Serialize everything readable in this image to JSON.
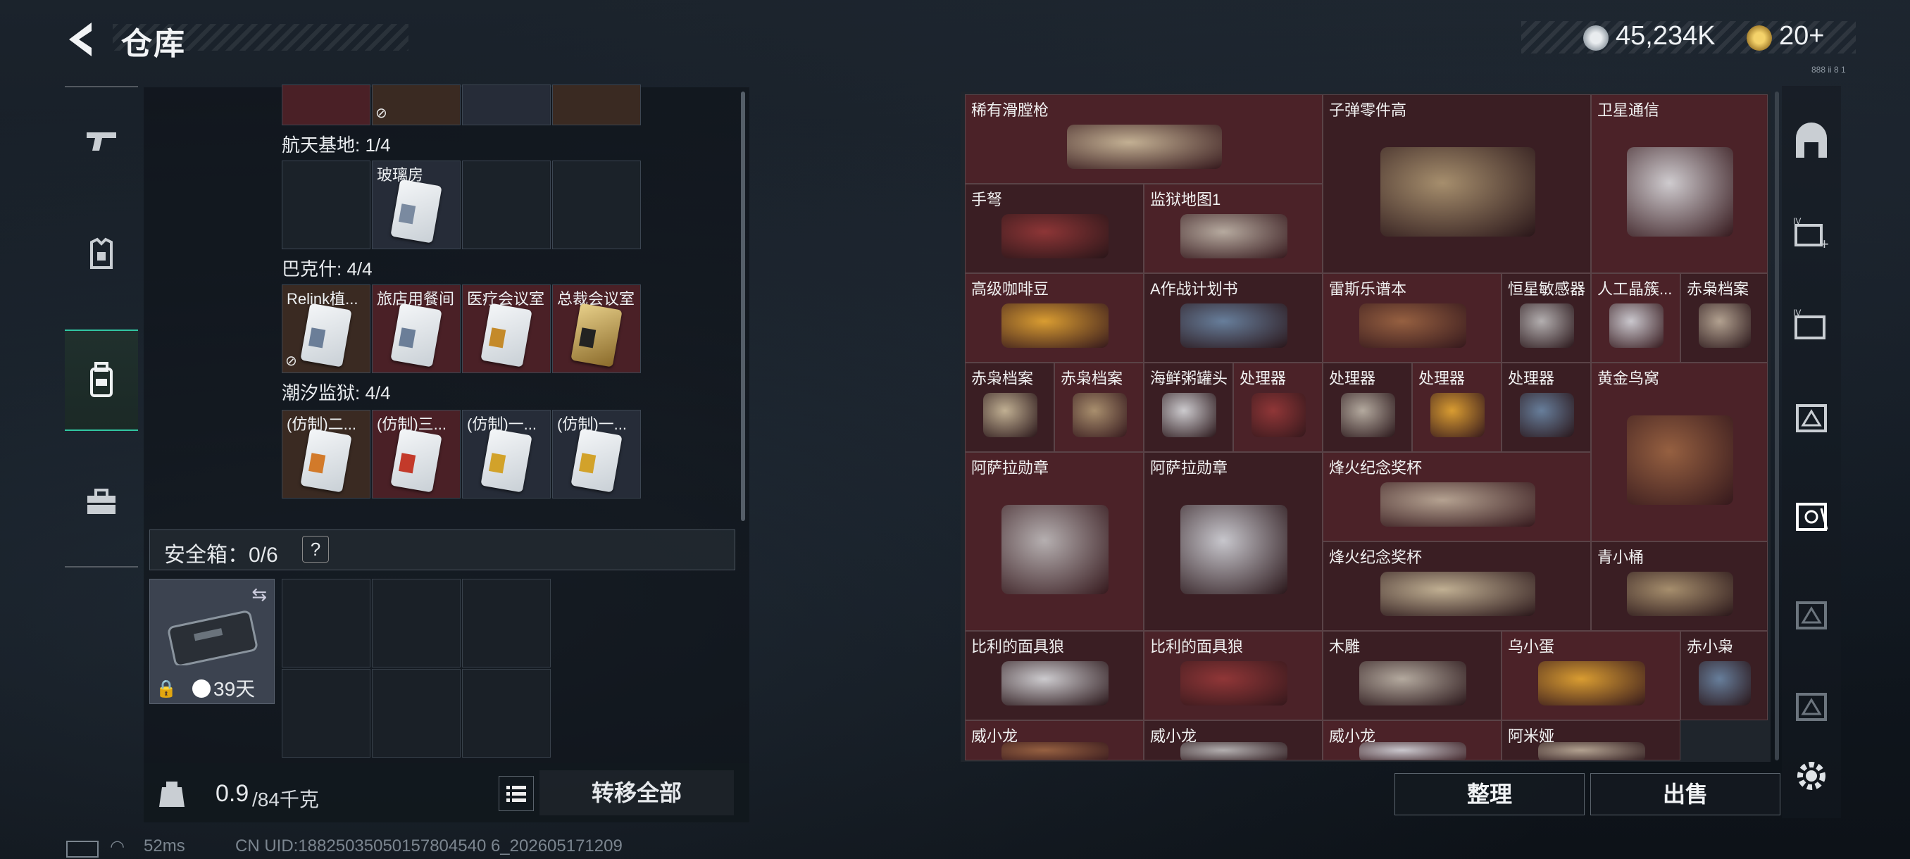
{
  "header": {
    "title": "仓库",
    "currency1": "45,234K",
    "currency2": "20+",
    "small_tag": "888 ii 8 1"
  },
  "left_panel": {
    "sections": [
      {
        "name": "航天基地: 1/4",
        "cells": [
          {
            "label": ""
          },
          {
            "label": "玻璃房"
          },
          {
            "label": ""
          },
          {
            "label": ""
          }
        ]
      },
      {
        "name": "巴克什: 4/4",
        "cells": [
          {
            "label": "Relink植..."
          },
          {
            "label": "旅店用餐间"
          },
          {
            "label": "医疗会议室"
          },
          {
            "label": "总裁会议室"
          }
        ]
      },
      {
        "name": "潮汐监狱: 4/4",
        "cells": [
          {
            "label": "(仿制)二..."
          },
          {
            "label": "(仿制)三..."
          },
          {
            "label": "(仿制)一..."
          },
          {
            "label": "(仿制)一..."
          }
        ]
      }
    ],
    "safe_label": "安全箱：0/6",
    "safe_help": "?",
    "safe_days": "39天",
    "weight_current": "0.9",
    "weight_max": "/84千克",
    "transfer_all": "转移全部"
  },
  "grid_items": [
    "稀有滑膛枪",
    "子弹零件高",
    "卫星通信",
    "手弩",
    "监狱地图1",
    "高级咖啡豆",
    "A作战计划书",
    "雷斯乐谱本",
    "恒星敏感器",
    "人工晶簇...",
    "赤枭档案",
    "赤枭档案",
    "赤枭档案",
    "海鲜粥罐头",
    "处理器",
    "处理器",
    "处理器",
    "处理器",
    "黄金鸟窝",
    "阿萨拉勋章",
    "阿萨拉勋章",
    "烽火纪念奖杯",
    "烽火纪念奖杯",
    "青小桶",
    "比利的面具狼",
    "比利的面具狼",
    "木雕",
    "乌小蛋",
    "赤小枭",
    "威小龙",
    "威小龙",
    "威小龙",
    "阿米娅"
  ],
  "right_buttons": {
    "sort": "整理",
    "sell": "出售"
  },
  "status": {
    "ping": "52ms",
    "uid": "CN UID:18825035050157804540 6_202605171209"
  },
  "icons": [
    "back-icon",
    "coin-icon",
    "gold-coin-icon",
    "gun-icon",
    "armor-icon",
    "backpack-icon",
    "briefcase-icon",
    "lock-icon",
    "clock-icon",
    "list-icon",
    "gear-icon",
    "weight-icon"
  ]
}
